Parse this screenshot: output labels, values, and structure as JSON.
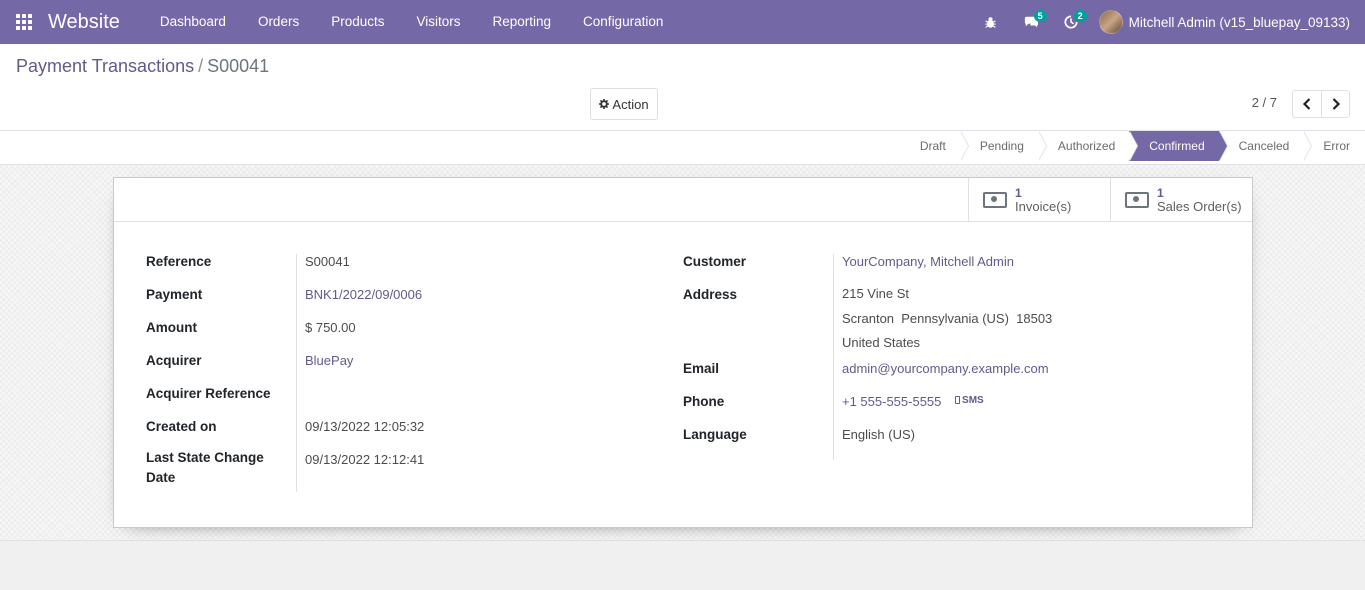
{
  "navbar": {
    "app_name": "Website",
    "menu": [
      "Dashboard",
      "Orders",
      "Products",
      "Visitors",
      "Reporting",
      "Configuration"
    ],
    "messages_badge": "5",
    "activities_badge": "2",
    "user": "Mitchell Admin (v15_bluepay_09133)"
  },
  "breadcrumb": {
    "parent": "Payment Transactions",
    "separator": "/",
    "current": "S00041"
  },
  "toolbar": {
    "action_label": "Action"
  },
  "pager": {
    "value": "2 / 7"
  },
  "statusbar": {
    "steps": [
      "Draft",
      "Pending",
      "Authorized",
      "Confirmed",
      "Canceled",
      "Error"
    ],
    "active": "Confirmed"
  },
  "button_box": {
    "invoices": {
      "count": "1",
      "label": "Invoice(s)"
    },
    "sales_orders": {
      "count": "1",
      "label": "Sales Order(s)"
    }
  },
  "form_left": {
    "reference": {
      "label": "Reference",
      "value": "S00041"
    },
    "payment": {
      "label": "Payment",
      "value": "BNK1/2022/09/0006"
    },
    "amount": {
      "label": "Amount",
      "value": "$ 750.00"
    },
    "acquirer": {
      "label": "Acquirer",
      "value": "BluePay"
    },
    "acquirer_reference": {
      "label": "Acquirer Reference",
      "value": ""
    },
    "created_on": {
      "label": "Created on",
      "value": "09/13/2022 12:05:32"
    },
    "last_state_change": {
      "label_1": "Last State Change",
      "label_2": "Date",
      "value": "09/13/2022 12:12:41"
    }
  },
  "form_right": {
    "customer": {
      "label": "Customer",
      "value": "YourCompany, Mitchell Admin"
    },
    "address": {
      "label": "Address",
      "street": "215 Vine St",
      "city_line": "Scranton  Pennsylvania (US)  18503",
      "country": "United States"
    },
    "email": {
      "label": "Email",
      "value": "admin@yourcompany.example.com"
    },
    "phone": {
      "label": "Phone",
      "value": "+1 555-555-5555",
      "sms": "SMS"
    },
    "language": {
      "label": "Language",
      "value": "English (US)"
    }
  }
}
